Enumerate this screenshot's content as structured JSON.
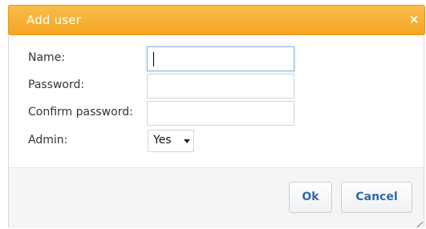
{
  "dialog": {
    "title": "Add user",
    "close_glyph": "×",
    "close_icon": "close-icon"
  },
  "form": {
    "name_label": "Name:",
    "name_value": "",
    "password_label": "Password:",
    "password_value": "",
    "confirm_label": "Confirm password:",
    "confirm_value": "",
    "admin_label": "Admin:",
    "admin_value": "Yes",
    "admin_icon": "chevron-down-icon"
  },
  "footer": {
    "ok_label": "Ok",
    "cancel_label": "Cancel",
    "resize_icon": "resize-grip-icon"
  },
  "colors": {
    "title_bar": "#f5a623",
    "button_text": "#2e6aa8"
  }
}
